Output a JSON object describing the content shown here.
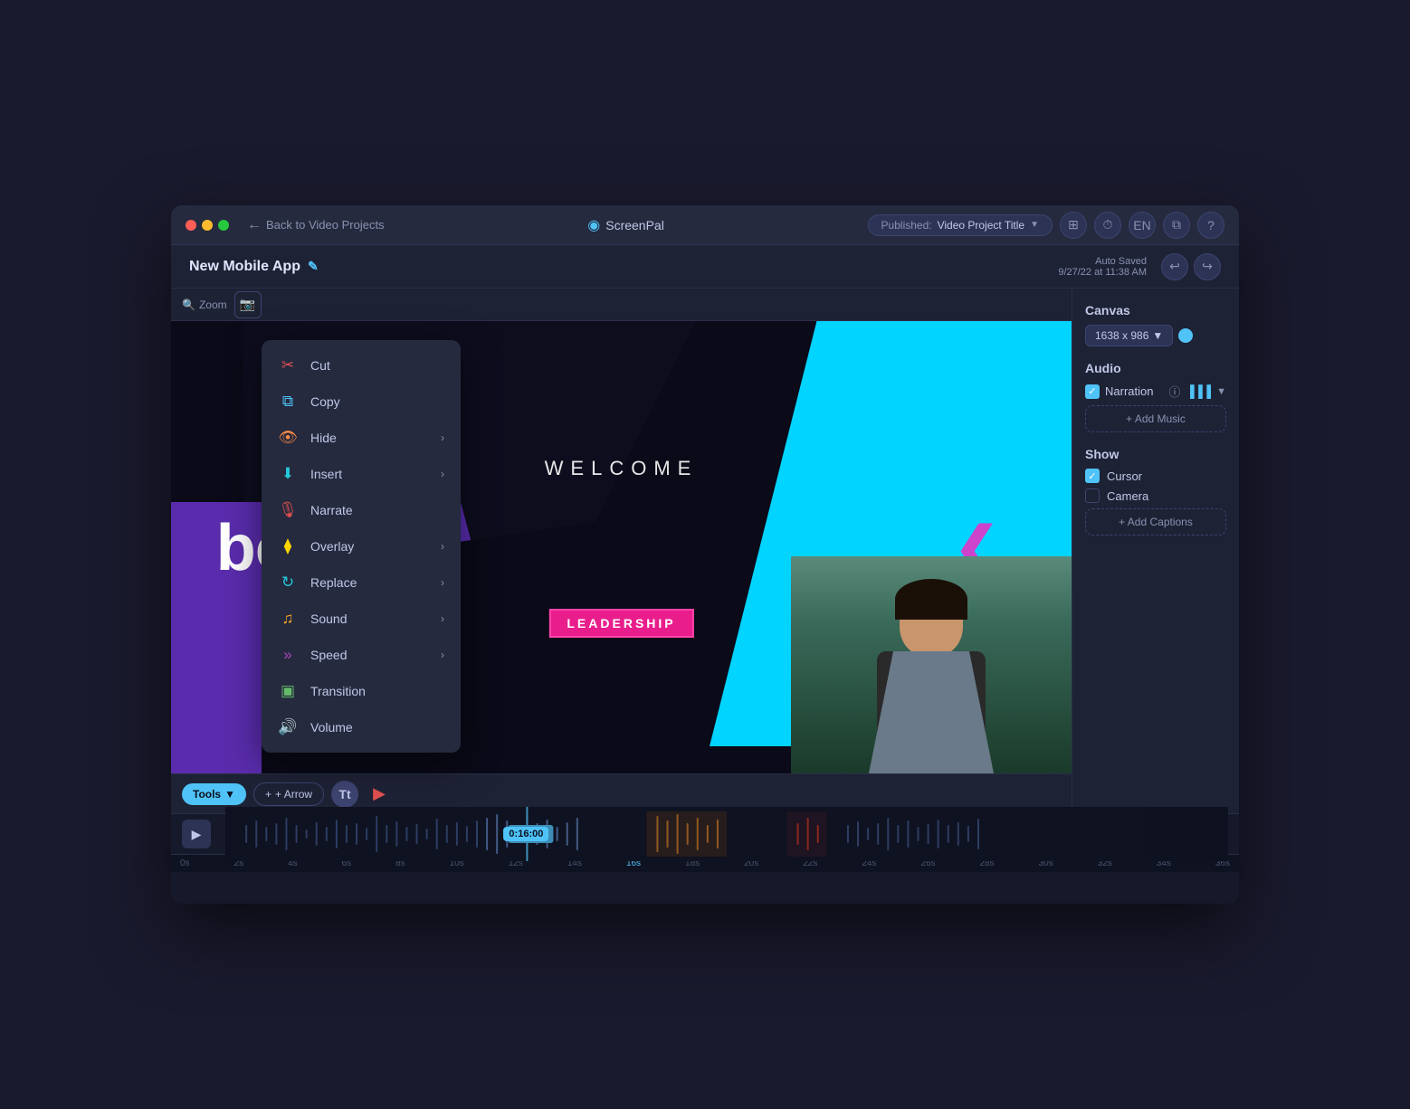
{
  "titleBar": {
    "back_label": "Back to Video Projects",
    "logo_text": "ScreenPal",
    "publish_label": "Published:",
    "project_title_dropdown": "Video Project Title",
    "icon_layers": "⊕",
    "icon_history": "⏱",
    "icon_lang": "EN",
    "icon_stack": "⧉",
    "icon_help": "?"
  },
  "projectBar": {
    "title": "New Mobile App",
    "autosave_line1": "Auto Saved",
    "autosave_line2": "9/27/22 at 11:38 AM"
  },
  "contextMenu": {
    "items": [
      {
        "label": "Cut",
        "icon": "✂",
        "icon_class": "icon-red",
        "has_arrow": false
      },
      {
        "label": "Copy",
        "icon": "⧉",
        "icon_class": "icon-blue-light",
        "has_arrow": false
      },
      {
        "label": "Hide",
        "icon": "👁",
        "icon_class": "icon-orange",
        "has_arrow": true
      },
      {
        "label": "Insert",
        "icon": "⬇",
        "icon_class": "icon-teal",
        "has_arrow": true
      },
      {
        "label": "Narrate",
        "icon": "🎙",
        "icon_class": "icon-red",
        "has_arrow": false
      },
      {
        "label": "Overlay",
        "icon": "⧫",
        "icon_class": "icon-yellow",
        "has_arrow": true
      },
      {
        "label": "Replace",
        "icon": "↻",
        "icon_class": "icon-teal",
        "has_arrow": true
      },
      {
        "label": "Sound",
        "icon": "♪",
        "icon_class": "icon-amber",
        "has_arrow": true
      },
      {
        "label": "Speed",
        "icon": "»",
        "icon_class": "icon-purple",
        "has_arrow": true
      },
      {
        "label": "Transition",
        "icon": "▣",
        "icon_class": "icon-green",
        "has_arrow": false
      },
      {
        "label": "Volume",
        "icon": "🔊",
        "icon_class": "icon-magenta",
        "has_arrow": false
      }
    ]
  },
  "canvas": {
    "welcome_text": "WELCOME",
    "about_text": "bout us",
    "leadership_text": "LEADERSHIP"
  },
  "rightPanel": {
    "canvas_section": "Canvas",
    "canvas_size": "1638 x 986",
    "audio_section": "Audio",
    "narration_label": "Narration",
    "add_music_label": "+ Add Music",
    "show_section": "Show",
    "cursor_label": "Cursor",
    "camera_label": "Camera",
    "add_captions_label": "+ Add Captions"
  },
  "bottomToolbar": {
    "tools_label": "Tools",
    "arrow_label": "+ Arrow",
    "tt_label": "Tt",
    "cursor_tool": "▶"
  },
  "timeline": {
    "play_icon": "▶",
    "timecode": "0:16:00",
    "time_markers": [
      "0s",
      "2s",
      "4s",
      "6s",
      "8s",
      "10s",
      "12s",
      "14s",
      "16s",
      "18s",
      "20s",
      "22s",
      "24s",
      "26s",
      "28s",
      "30s",
      "32s",
      "34s",
      "36s"
    ]
  }
}
